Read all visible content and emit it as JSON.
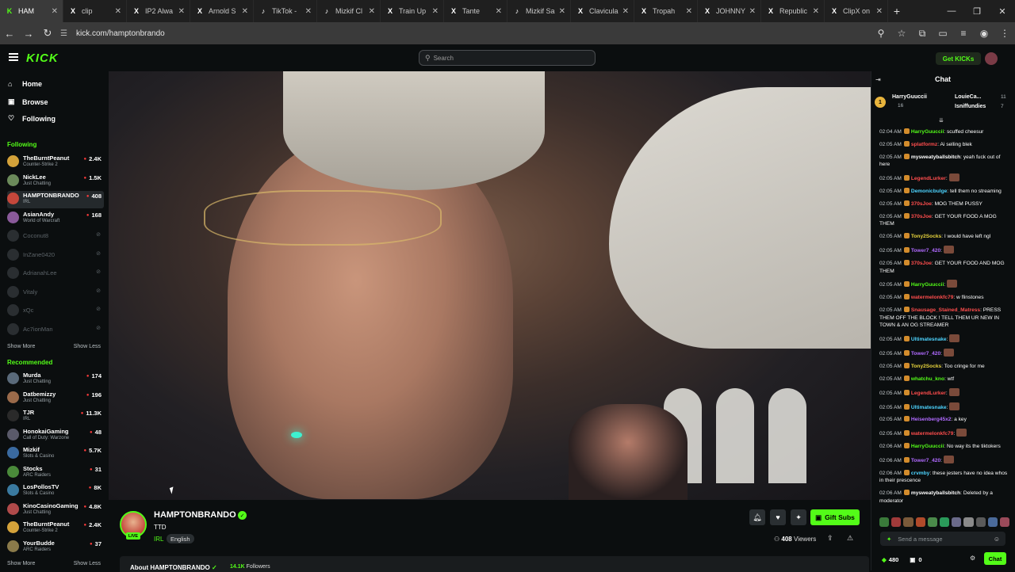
{
  "browser": {
    "tabs": [
      {
        "label": "HAM",
        "fav": "K",
        "fav_color": "#53fc18",
        "active": true
      },
      {
        "label": "clip",
        "fav": "X",
        "fav_color": "#ffffff"
      },
      {
        "label": "IP2 Alwa",
        "fav": "X",
        "fav_color": "#ffffff"
      },
      {
        "label": "Arnold S",
        "fav": "X",
        "fav_color": "#ffffff"
      },
      {
        "label": "TikTok -",
        "fav": "♪",
        "fav_color": "#ffffff"
      },
      {
        "label": "Mizkif Cl",
        "fav": "♪",
        "fav_color": "#ffffff"
      },
      {
        "label": "Train Up",
        "fav": "X",
        "fav_color": "#ffffff"
      },
      {
        "label": "Tante",
        "fav": "X",
        "fav_color": "#ffffff"
      },
      {
        "label": "Mizkif Sa",
        "fav": "♪",
        "fav_color": "#ffffff"
      },
      {
        "label": "Clavicula",
        "fav": "X",
        "fav_color": "#ffffff"
      },
      {
        "label": "Tropah",
        "fav": "X",
        "fav_color": "#ffffff"
      },
      {
        "label": "JOHNNY",
        "fav": "X",
        "fav_color": "#ffffff"
      },
      {
        "label": "Republic",
        "fav": "X",
        "fav_color": "#ffffff"
      },
      {
        "label": "ClipX on",
        "fav": "X",
        "fav_color": "#ffffff"
      }
    ],
    "url": "kick.com/hamptonbrando"
  },
  "top": {
    "logo": "KICK",
    "search_placeholder": "Search",
    "get_kicks": "Get KICKs"
  },
  "sidebar": {
    "nav": [
      {
        "label": "Home",
        "icon": "home-icon",
        "glyph": "⌂"
      },
      {
        "label": "Browse",
        "icon": "browse-icon",
        "glyph": "▣"
      },
      {
        "label": "Following",
        "icon": "heart-icon",
        "glyph": "♡"
      }
    ],
    "following_title": "Following",
    "following": [
      {
        "name": "TheBurntPeanut",
        "cat": "Counter-Strike 2",
        "viewers": "2.4K",
        "color": "#d4a23a"
      },
      {
        "name": "NickLee",
        "cat": "Just Chatting",
        "viewers": "1.5K",
        "color": "#6b8a5a"
      },
      {
        "name": "HAMPTONBRANDO",
        "cat": "IRL",
        "viewers": "408",
        "color": "#c4473b"
      },
      {
        "name": "AsianAndy",
        "cat": "World of Warcraft",
        "viewers": "168",
        "color": "#8a5a9a"
      },
      {
        "name": "Coconut8",
        "offline": true
      },
      {
        "name": "InZane0420",
        "offline": true
      },
      {
        "name": "AdrianahLee",
        "offline": true
      },
      {
        "name": "Vitaly",
        "offline": true
      },
      {
        "name": "xQc",
        "offline": true
      },
      {
        "name": "Ac7ionMan",
        "offline": true
      }
    ],
    "show_more": "Show More",
    "show_less": "Show Less",
    "recommended_title": "Recommended",
    "recommended": [
      {
        "name": "Murda",
        "cat": "Just Chatting",
        "viewers": "174",
        "color": "#5a6a7a"
      },
      {
        "name": "Datbemizzy",
        "cat": "Just Chatting",
        "viewers": "196",
        "color": "#9a6a4a"
      },
      {
        "name": "TJR",
        "cat": "IRL",
        "viewers": "11.3K",
        "color": "#2a2a2a"
      },
      {
        "name": "HonokaiGaming",
        "cat": "Call of Duty: Warzone",
        "viewers": "48",
        "color": "#5a5a6a"
      },
      {
        "name": "Mizkif",
        "cat": "Slots & Casino",
        "viewers": "5.7K",
        "color": "#3a6aa0"
      },
      {
        "name": "Stocks",
        "cat": "ARC Raiders",
        "viewers": "31",
        "color": "#4a8a3a"
      },
      {
        "name": "LosPollosTV",
        "cat": "Slots & Casino",
        "viewers": "8K",
        "color": "#3a7aa0"
      },
      {
        "name": "KinoCasinoGaming",
        "cat": "Just Chatting",
        "viewers": "4.8K",
        "color": "#b04a4a"
      },
      {
        "name": "TheBurntPeanut",
        "cat": "Counter-Strike 2",
        "viewers": "2.4K",
        "color": "#d4a23a"
      },
      {
        "name": "YourBudde",
        "cat": "ARC Raiders",
        "viewers": "37",
        "color": "#8a7a4a"
      }
    ]
  },
  "channel": {
    "name": "HAMPTONBRANDO",
    "live_label": "LIVE",
    "title": "TTD",
    "category": "IRL",
    "language": "English",
    "gift_subs": "Gift Subs",
    "viewers_count": "408",
    "viewers_label": "Viewers",
    "about_title": "About HAMPTONBRANDO",
    "followers_count": "14.1K",
    "followers_label": "Followers"
  },
  "chat": {
    "title": "Chat",
    "leaderboard": [
      {
        "name": "HarryGuuccii",
        "count": "16",
        "color": "#e8b43c"
      },
      {
        "name": "LouieCa...",
        "count": "11",
        "color": "#ffffff"
      },
      {
        "name": "Isniffundies",
        "count": "7",
        "color": "#e8b43c"
      }
    ],
    "messages": [
      {
        "time": "02:04 AM",
        "user": "HarryGuuccii",
        "color": "#53fc18",
        "text": "scuffed cheesur"
      },
      {
        "time": "02:05 AM",
        "user": "splatformz",
        "color": "#ff4d4d",
        "text": "Ai selling blek"
      },
      {
        "time": "02:05 AM",
        "user": "mysweatyballsbitch",
        "color": "#ffffff",
        "text": "yeah fuck out of here"
      },
      {
        "time": "02:05 AM",
        "user": "LegendLurker",
        "color": "#ff4d4d",
        "text": "",
        "emote": true
      },
      {
        "time": "02:05 AM",
        "user": "Demonicbulge",
        "color": "#4dd4ff",
        "text": "tell them no streaming"
      },
      {
        "time": "02:05 AM",
        "user": "370sJoe",
        "color": "#ff4d4d",
        "text": "MOG THEM PUSSY"
      },
      {
        "time": "02:05 AM",
        "user": "370sJoe",
        "color": "#ff4d4d",
        "text": "GET YOUR FOOD A MOG THEM"
      },
      {
        "time": "02:05 AM",
        "user": "Tony2Socks",
        "color": "#e8d43c",
        "text": "I would have left ngl"
      },
      {
        "time": "02:05 AM",
        "user": "Tower7_420",
        "color": "#b06aff",
        "text": "",
        "emote": true
      },
      {
        "time": "02:05 AM",
        "user": "370sJoe",
        "color": "#ff4d4d",
        "text": "GET YOUR FOOD AND MOG THEM"
      },
      {
        "time": "02:05 AM",
        "user": "HarryGuuccii",
        "color": "#53fc18",
        "text": "",
        "emote": true
      },
      {
        "time": "02:05 AM",
        "user": "watermelonkfc79",
        "color": "#ff4d4d",
        "text": "w flinstones"
      },
      {
        "time": "02:05 AM",
        "user": "Snausage_Stained_Matress",
        "color": "#ff4d4d",
        "text": "PRESS THEM OFF THE BLOCK ! TELL THEM UR NEW IN TOWN & AN OG STREAMER"
      },
      {
        "time": "02:05 AM",
        "user": "Ultimatesnake",
        "color": "#4dd4ff",
        "text": "",
        "emote": true
      },
      {
        "time": "02:05 AM",
        "user": "Tower7_420",
        "color": "#b06aff",
        "text": "",
        "emote": true
      },
      {
        "time": "02:05 AM",
        "user": "Tony2Socks",
        "color": "#e8d43c",
        "text": "Too cringe for me"
      },
      {
        "time": "02:05 AM",
        "user": "whatchu_kno",
        "color": "#53fc18",
        "text": "wtf"
      },
      {
        "time": "02:05 AM",
        "user": "LegendLurker",
        "color": "#ff4d4d",
        "text": "",
        "emote": true
      },
      {
        "time": "02:05 AM",
        "user": "Ultimatesnake",
        "color": "#4dd4ff",
        "text": "",
        "emote": true
      },
      {
        "time": "02:05 AM",
        "user": "Heisenberg45x2",
        "color": "#b06aff",
        "text": "a key"
      },
      {
        "time": "02:05 AM",
        "user": "watermelonkfc79",
        "color": "#ff4d4d",
        "text": "",
        "emote": true
      },
      {
        "time": "02:06 AM",
        "user": "HarryGuuccii",
        "color": "#53fc18",
        "text": "No way its the tiktokers"
      },
      {
        "time": "02:06 AM",
        "user": "Tower7_420",
        "color": "#b06aff",
        "text": "",
        "emote": true
      },
      {
        "time": "02:06 AM",
        "user": "crvmby",
        "color": "#4dd4ff",
        "text": "these jesters have no idea whos in their prescence"
      },
      {
        "time": "02:06 AM",
        "user": "mysweatyballsbitch",
        "color": "#ffffff",
        "text": "Deleted by a moderator"
      }
    ],
    "input_placeholder": "Send a message",
    "kicks_count": "480",
    "points_count": "0",
    "chat_button": "Chat"
  }
}
